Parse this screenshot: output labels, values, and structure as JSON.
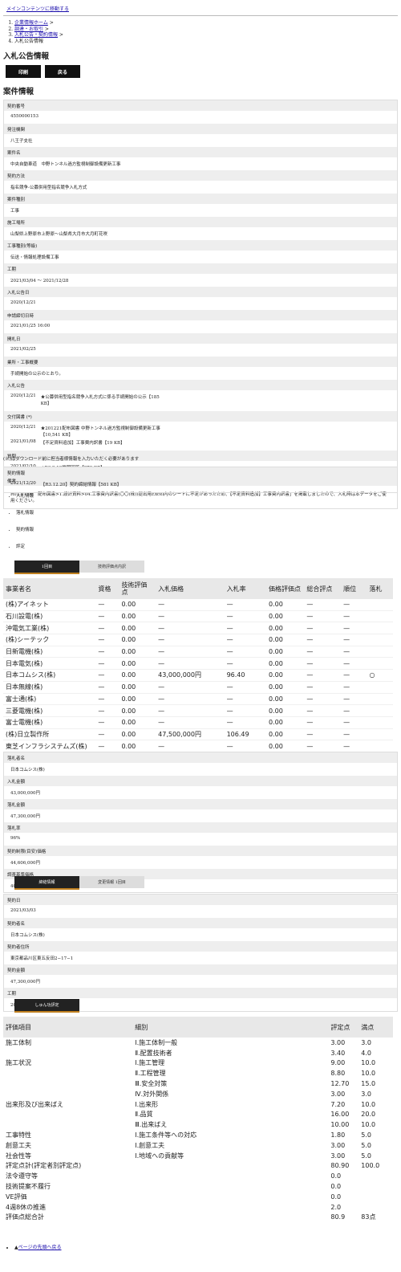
{
  "skip_link": "メインコンテンツに移動する",
  "breadcrumb": [
    "企業情報ホーム",
    "調達・お取引",
    "入札公告・契約情報",
    "入札公告情報"
  ],
  "page_title": "入札公告情報",
  "buttons": {
    "print": "印刷",
    "back": "戻る"
  },
  "section_title": "案件情報",
  "fields": [
    {
      "label": "契約番号",
      "value": "4550000153"
    },
    {
      "label": "発注機関",
      "value": "八王子支社"
    },
    {
      "label": "案件名",
      "value": "中央自動車道　中野トンネル過方監視制御設備更新工事"
    },
    {
      "label": "契約方法",
      "value": "指名競争-公募併用型指名競争入札方式"
    },
    {
      "label": "案件種別",
      "value": "工事"
    },
    {
      "label": "施工場所",
      "value": "山梨県上野原市上野原～山梨県大月市大月町花咲"
    },
    {
      "label": "工事種別(等級)",
      "value": "伝送・情報処理設備工事"
    },
    {
      "label": "工期",
      "value": "2021/03/04 ～ 2021/12/28"
    },
    {
      "label": "入札公告日",
      "value": "2020/12/21"
    },
    {
      "label": "申請締切日時",
      "value": "2021/01/25 16:00"
    },
    {
      "label": "開札日",
      "value": "2021/02/25"
    },
    {
      "label": "業所・工事概要",
      "value": "手続開始の公示のとおり。"
    }
  ],
  "notice": {
    "label": "入札公告",
    "date": "2020/12/21",
    "link": "★公募併用型指名競争入札方式に係る手続開始の公示【185 KB】"
  },
  "docs": {
    "label": "交付図書 (*)",
    "items": [
      {
        "date": "2020/12/21",
        "text": "★201221配布図書 中野トンネル過方監視制御設備更新工事【10,541 KB】"
      },
      {
        "date": "2021/01/08",
        "text": "【不足資料追加】工事費内訳書【19 KB】"
      }
    ]
  },
  "qa": {
    "label": "質問",
    "date": "2021/02/10",
    "text": "★R3.2.10質問回答【270 KB】"
  },
  "remarks": {
    "label": "備考",
    "text": "R03.01.08　配布図書>1.設計資料>04.工事費内訳書(〇〇(株))提出用Excel内のシートに不足があったため、【不足資料追加】工事費内訳書」を掲載しましたので、入札時は本データをご使用ください。"
  },
  "download_note": "(※)はダウンロード前に担当者様情報を入力いただく必要があります",
  "contract_info": {
    "label": "契約情報",
    "date": "2021/12/20",
    "text": "【R3.12.20】契約締結情報【581 KB】"
  },
  "side_links": [
    "入札情報",
    "落札情報",
    "契約情報",
    "評定"
  ],
  "tabs1": [
    "1回目",
    "技術評価点内訳"
  ],
  "bid_headers": [
    "事業者名",
    "資格",
    "技術評価点",
    "入札価格",
    "入札率",
    "価格評価点",
    "総合評点",
    "順位",
    "落札"
  ],
  "bid_rows": [
    [
      "(株)アイネット",
      "—",
      "0.00",
      "—",
      "—",
      "0.00",
      "—",
      "—",
      ""
    ],
    [
      "石川設電(株)",
      "—",
      "0.00",
      "—",
      "—",
      "0.00",
      "—",
      "—",
      ""
    ],
    [
      "沖電気工業(株)",
      "—",
      "0.00",
      "—",
      "—",
      "0.00",
      "—",
      "—",
      ""
    ],
    [
      "(株)シーテック",
      "—",
      "0.00",
      "—",
      "—",
      "0.00",
      "—",
      "—",
      ""
    ],
    [
      "日新電機(株)",
      "—",
      "0.00",
      "—",
      "—",
      "0.00",
      "—",
      "—",
      ""
    ],
    [
      "日本電気(株)",
      "—",
      "0.00",
      "—",
      "—",
      "0.00",
      "—",
      "—",
      ""
    ],
    [
      "日本コムシス(株)",
      "—",
      "0.00",
      "43,000,000円",
      "96.40",
      "0.00",
      "—",
      "—",
      "○"
    ],
    [
      "日本無線(株)",
      "—",
      "0.00",
      "—",
      "—",
      "0.00",
      "—",
      "—",
      ""
    ],
    [
      "富士通(株)",
      "—",
      "0.00",
      "—",
      "—",
      "0.00",
      "—",
      "—",
      ""
    ],
    [
      "三菱電機(株)",
      "—",
      "0.00",
      "—",
      "—",
      "0.00",
      "—",
      "—",
      ""
    ],
    [
      "富士電機(株)",
      "—",
      "0.00",
      "—",
      "—",
      "0.00",
      "—",
      "—",
      ""
    ],
    [
      "(株)日立製作所",
      "—",
      "0.00",
      "47,500,000円",
      "106.49",
      "0.00",
      "—",
      "—",
      ""
    ],
    [
      "東芝インフラシステムズ(株)",
      "—",
      "0.00",
      "—",
      "—",
      "0.00",
      "—",
      "—",
      ""
    ]
  ],
  "award": [
    {
      "label": "落札者名",
      "value": "日本コムシス(株)"
    },
    {
      "label": "入札金額",
      "value": "43,000,000円"
    },
    {
      "label": "落札金額",
      "value": "47,300,000円"
    },
    {
      "label": "落札率",
      "value": "96%"
    },
    {
      "label": "契約制限(目安)価格",
      "value": "44,606,000円"
    },
    {
      "label": "調査基準価格",
      "value": "40,274,669円"
    }
  ],
  "tabs2": [
    "締結情報",
    "変更情報 1回目"
  ],
  "contract": [
    {
      "label": "契約日",
      "value": "2021/03/03"
    },
    {
      "label": "契約者名",
      "value": "日本コムシス(株)"
    },
    {
      "label": "契約者住所",
      "value": "東京都品川区東五反田2−17−1"
    },
    {
      "label": "契約金額",
      "value": "47,300,000円"
    },
    {
      "label": "工期",
      "value": "2021/03/04 ～ 2021/12/28"
    }
  ],
  "eval_tab": "しゅん功評定",
  "eval_headers": [
    "評価項目",
    "細別",
    "評定点",
    "満点"
  ],
  "eval_rows": [
    [
      "施工体制",
      "Ⅰ.施工体制一般",
      "3.00",
      "3.0"
    ],
    [
      "",
      "Ⅱ.配置技術者",
      "3.40",
      "4.0"
    ],
    [
      "施工状況",
      "Ⅰ.施工管理",
      "9.00",
      "10.0"
    ],
    [
      "",
      "Ⅱ.工程管理",
      "8.80",
      "10.0"
    ],
    [
      "",
      "Ⅲ.安全対策",
      "12.70",
      "15.0"
    ],
    [
      "",
      "Ⅳ.対外関係",
      "3.00",
      "3.0"
    ],
    [
      "出来形及び出来ばえ",
      "Ⅰ.出来形",
      "7.20",
      "10.0"
    ],
    [
      "",
      "Ⅱ.品質",
      "16.00",
      "20.0"
    ],
    [
      "",
      "Ⅲ.出来ばえ",
      "10.00",
      "10.0"
    ],
    [
      "工事特性",
      "Ⅰ.施工条件等への対応",
      "1.80",
      "5.0"
    ],
    [
      "創意工夫",
      "Ⅰ.創意工夫",
      "3.00",
      "5.0"
    ],
    [
      "社会性等",
      "Ⅰ.地域への貢献等",
      "3.00",
      "5.0"
    ],
    [
      "評定点計(評定者別評定点)",
      "",
      "80.90",
      "100.0"
    ],
    [
      "法令遵守等",
      "",
      "0.0",
      ""
    ],
    [
      "技術提案不履行",
      "",
      "0.0",
      ""
    ],
    [
      "VE評価",
      "",
      "0.0",
      ""
    ],
    [
      "4週8休の推進",
      "",
      "2.0",
      ""
    ],
    [
      "評価点総合計",
      "",
      "80.9",
      "83点"
    ]
  ],
  "back_to_top": "ページの先頭へ戻る"
}
